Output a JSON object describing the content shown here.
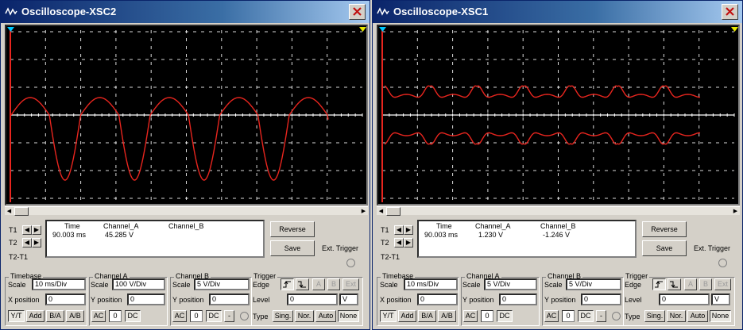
{
  "windows": [
    {
      "title": "Oscilloscope-XSC2",
      "readout": {
        "t1": "T1",
        "t2": "T2",
        "t2t1": "T2-T1",
        "hdr_time": "Time",
        "hdr_cha": "Channel_A",
        "hdr_chb": "Channel_B",
        "time": "90.003 ms",
        "cha": "45.285 V",
        "chb": ""
      },
      "buttons": {
        "reverse": "Reverse",
        "save": "Save",
        "ext_trigger": "Ext. Trigger"
      },
      "timebase": {
        "title": "Timebase",
        "scale_label": "Scale",
        "scale": "10 ms/Div",
        "xpos_label": "X position",
        "xpos": "0",
        "modes": [
          "Y/T",
          "Add",
          "B/A",
          "A/B"
        ]
      },
      "channel_a": {
        "title": "Channel A",
        "scale_label": "Scale",
        "scale": "100  V/Div",
        "ypos_label": "Y position",
        "ypos": "0",
        "coupling": [
          "AC",
          "0",
          "DC"
        ]
      },
      "channel_b": {
        "title": "Channel B",
        "scale_label": "Scale",
        "scale": "5  V/Div",
        "ypos_label": "Y position",
        "ypos": "0",
        "coupling": [
          "AC",
          "0",
          "DC",
          "-"
        ]
      },
      "trigger": {
        "title": "Trigger",
        "edge_label": "Edge",
        "sources": [
          "A",
          "B",
          "Ext"
        ],
        "level_label": "Level",
        "level": "0",
        "level_unit": "V",
        "type_label": "Type",
        "types": [
          "Sing.",
          "Nor.",
          "Auto",
          "None"
        ]
      },
      "waveform": "rectified"
    },
    {
      "title": "Oscilloscope-XSC1",
      "readout": {
        "t1": "T1",
        "t2": "T2",
        "t2t1": "T2-T1",
        "hdr_time": "Time",
        "hdr_cha": "Channel_A",
        "hdr_chb": "Channel_B",
        "time": "90.003 ms",
        "cha": "1.230 V",
        "chb": "-1.246 V"
      },
      "buttons": {
        "reverse": "Reverse",
        "save": "Save",
        "ext_trigger": "Ext. Trigger"
      },
      "timebase": {
        "title": "Timebase",
        "scale_label": "Scale",
        "scale": "10 ms/Div",
        "xpos_label": "X position",
        "xpos": "0",
        "modes": [
          "Y/T",
          "Add",
          "B/A",
          "A/B"
        ]
      },
      "channel_a": {
        "title": "Channel A",
        "scale_label": "Scale",
        "scale": "5  V/Div",
        "ypos_label": "Y position",
        "ypos": "0",
        "coupling": [
          "AC",
          "0",
          "DC"
        ]
      },
      "channel_b": {
        "title": "Channel B",
        "scale_label": "Scale",
        "scale": "5  V/Div",
        "ypos_label": "Y position",
        "ypos": "0",
        "coupling": [
          "AC",
          "0",
          "DC",
          "-"
        ]
      },
      "trigger": {
        "title": "Trigger",
        "edge_label": "Edge",
        "sources": [
          "A",
          "B",
          "Ext"
        ],
        "level_label": "Level",
        "level": "0",
        "level_unit": "V",
        "type_label": "Type",
        "types": [
          "Sing.",
          "Nor.",
          "Auto",
          "None"
        ]
      },
      "waveform": "modulated"
    }
  ],
  "colors": {
    "trace": "#e8251e",
    "grid": "#ffffff",
    "cursor_t1": "#e8251e",
    "cursor_marker_t1": "#00c8ff",
    "cursor_marker_t2": "#e8e800",
    "screen": "#000000"
  }
}
